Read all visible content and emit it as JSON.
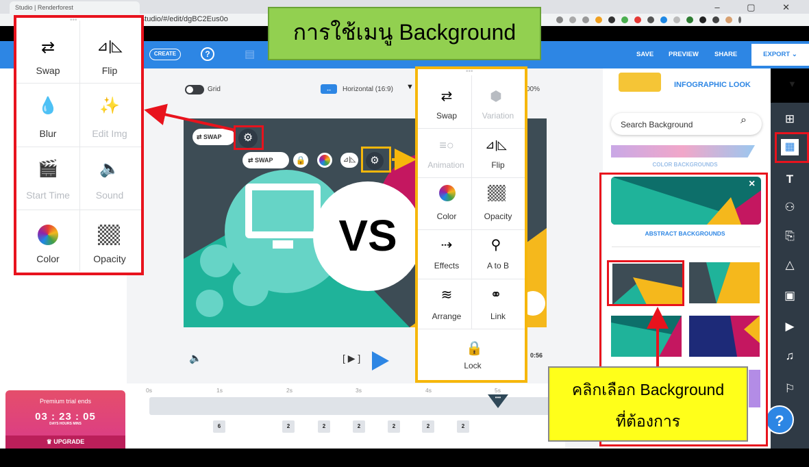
{
  "browser": {
    "tab_title": "Studio | Renderforest",
    "window_controls": "–  ▢  ✕",
    "url": "-studio/#/edit/dgBC2Eus0o"
  },
  "toolbar": {
    "create_label": "CREATE",
    "help_label": "?",
    "save_label": "SAVE",
    "preview_label": "PREVIEW",
    "share_label": "SHARE",
    "export_label": "EXPORT ⌄"
  },
  "canvas_toolbar": {
    "grid_label": "Grid",
    "orientation_label": "Horizontal (16:9)",
    "orientation_caret": "▼",
    "zoom_label": "00%"
  },
  "title_overlay": "การใช้เมนู Background",
  "vs_label": "VS",
  "left_popup": {
    "items": [
      {
        "icon": "⇄",
        "label": "Swap",
        "disabled": false
      },
      {
        "icon": "⊿|◺",
        "label": "Flip",
        "disabled": false
      },
      {
        "icon": "💧",
        "label": "Blur",
        "disabled": false
      },
      {
        "icon": "✨",
        "label": "Edit Img",
        "disabled": true
      },
      {
        "icon": "🎬",
        "label": "Start Time",
        "disabled": true
      },
      {
        "icon": "🔈",
        "label": "Sound",
        "disabled": true
      },
      {
        "icon": "◕",
        "label": "Color",
        "disabled": false
      },
      {
        "icon": "▦",
        "label": "Opacity",
        "disabled": false
      }
    ]
  },
  "mid_popup": {
    "items": [
      {
        "icon": "⇄",
        "label": "Swap",
        "disabled": false
      },
      {
        "icon": "⬢",
        "label": "Variation",
        "disabled": true
      },
      {
        "icon": "≡○",
        "label": "Animation",
        "disabled": true
      },
      {
        "icon": "⊿|◺",
        "label": "Flip",
        "disabled": false
      },
      {
        "icon": "◕",
        "label": "Color",
        "disabled": false
      },
      {
        "icon": "▦",
        "label": "Opacity",
        "disabled": false
      },
      {
        "icon": "⇢",
        "label": "Effects",
        "disabled": false
      },
      {
        "icon": "⚲",
        "label": "A to B",
        "disabled": false
      },
      {
        "icon": "≋",
        "label": "Arrange",
        "disabled": false
      },
      {
        "icon": "⚭",
        "label": "Link",
        "disabled": false
      }
    ],
    "lock_label": "Lock"
  },
  "canvas_scene": {
    "swap_label": "SWAP",
    "swap_label_2": "SWAP"
  },
  "player": {
    "sound_icon": "🔈",
    "frame_icon": "[ ▶ ]",
    "time_end": "0:56"
  },
  "timeline": {
    "ticks": [
      "0s",
      "1s",
      "2s",
      "3s",
      "4s",
      "5s"
    ],
    "chips": [
      "6",
      "2",
      "2",
      "2",
      "2",
      "2",
      "2"
    ],
    "playhead_dots": "•••"
  },
  "premium": {
    "label": "Premium trial ends",
    "time": "03 : 23 : 05",
    "units": "DAYS        HOURS        MINS",
    "upgrade_label": "UPGRADE"
  },
  "right_panel": {
    "look_label": "INFOGRAPHIC LOOK",
    "look_caret": "▼",
    "search_placeholder": "Search Background",
    "color_backgrounds_label": "COLOR BACKGROUNDS",
    "abstract_backgrounds_label": "ABSTRACT BACKGROUNDS",
    "close_label": "×"
  },
  "hint": {
    "line1": "คลิกเลือก Background",
    "line2": "ที่ต้องการ"
  },
  "help_button": "?",
  "colors": {
    "accent": "#2d86e4",
    "annotation_red": "#e8131d",
    "annotation_yellow": "#f6b70b",
    "title_green": "#92d050",
    "hint_yellow": "#ffff1a"
  }
}
